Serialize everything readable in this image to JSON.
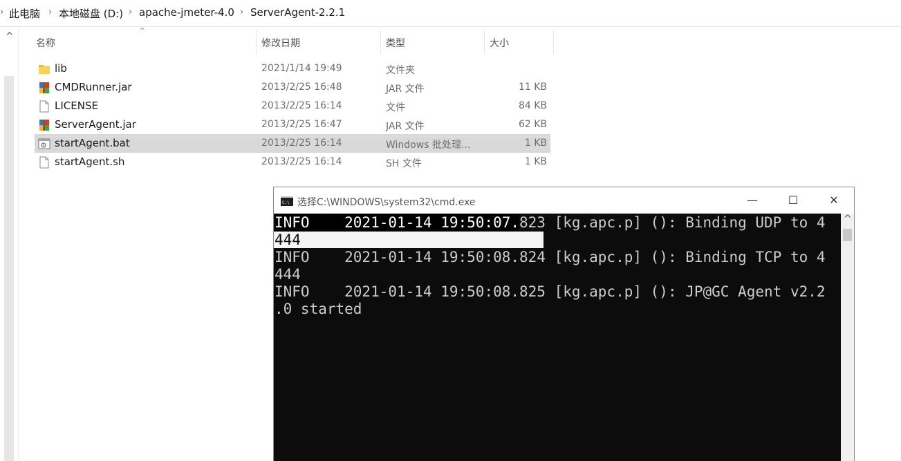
{
  "breadcrumb": {
    "items": [
      "此电脑",
      "本地磁盘 (D:)",
      "apache-jmeter-4.0",
      "ServerAgent-2.2.1"
    ],
    "separator": "›"
  },
  "columns": {
    "name": "名称",
    "date": "修改日期",
    "type": "类型",
    "size": "大小",
    "sort_caret": "^"
  },
  "files": [
    {
      "name": "lib",
      "date": "2021/1/14 19:49",
      "type": "文件夹",
      "size": "",
      "icon": "folder-icon"
    },
    {
      "name": "CMDRunner.jar",
      "date": "2013/2/25 16:48",
      "type": "JAR 文件",
      "size": "11 KB",
      "icon": "jar-icon"
    },
    {
      "name": "LICENSE",
      "date": "2013/2/25 16:14",
      "type": "文件",
      "size": "84 KB",
      "icon": "file-icon"
    },
    {
      "name": "ServerAgent.jar",
      "date": "2013/2/25 16:47",
      "type": "JAR 文件",
      "size": "62 KB",
      "icon": "jar-icon"
    },
    {
      "name": "startAgent.bat",
      "date": "2013/2/25 16:14",
      "type": "Windows 批处理...",
      "size": "1 KB",
      "icon": "bat-icon",
      "selected": true
    },
    {
      "name": "startAgent.sh",
      "date": "2013/2/25 16:14",
      "type": "SH 文件",
      "size": "1 KB",
      "icon": "file-icon"
    }
  ],
  "cmd": {
    "title": "选择C:\\WINDOWS\\system32\\cmd.exe",
    "minimize": "—",
    "maximize": "☐",
    "close": "✕",
    "scroll_up": "^",
    "lines": {
      "l1_sel": "INFO    2021-01-14 19:50:07.",
      "l1_rest": "823 [kg.apc.p] (): Binding UDP to 4",
      "l2_sel": "444",
      "l3": "INFO    2021-01-14 19:50:08.824 [kg.apc.p] (): Binding TCP to 4",
      "l4": "444",
      "l5": "INFO    2021-01-14 19:50:08.825 [kg.apc.p] (): JP@GC Agent v2.2",
      "l6": ".0 started"
    }
  },
  "left_pane": {
    "scroll_up": "^"
  }
}
